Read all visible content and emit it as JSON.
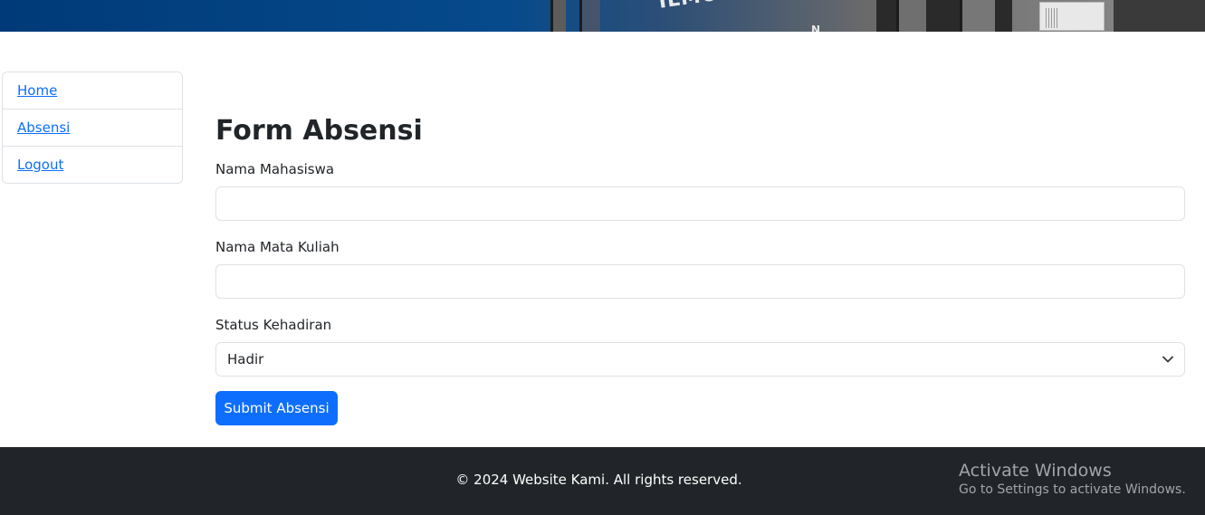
{
  "banner": {
    "sign_text": "ILMU KOMPUTE",
    "sign_text_lower": "N"
  },
  "sidebar": {
    "items": [
      {
        "label": "Home"
      },
      {
        "label": "Absensi"
      },
      {
        "label": "Logout"
      }
    ]
  },
  "form": {
    "title": "Form Absensi",
    "fields": [
      {
        "label": "Nama Mahasiswa",
        "value": "",
        "placeholder": ""
      },
      {
        "label": "Nama Mata Kuliah",
        "value": "",
        "placeholder": ""
      }
    ],
    "status": {
      "label": "Status Kehadiran",
      "selected": "Hadir"
    },
    "submit_label": "Submit Absensi"
  },
  "footer": {
    "copyright": "© 2024 Website Kami. All rights reserved."
  },
  "os_overlay": {
    "title": "Activate Windows",
    "subtitle": "Go to Settings to activate Windows."
  },
  "colors": {
    "primary": "#0d6efd",
    "footer_bg": "#212529",
    "banner_blue": "#003a78"
  }
}
